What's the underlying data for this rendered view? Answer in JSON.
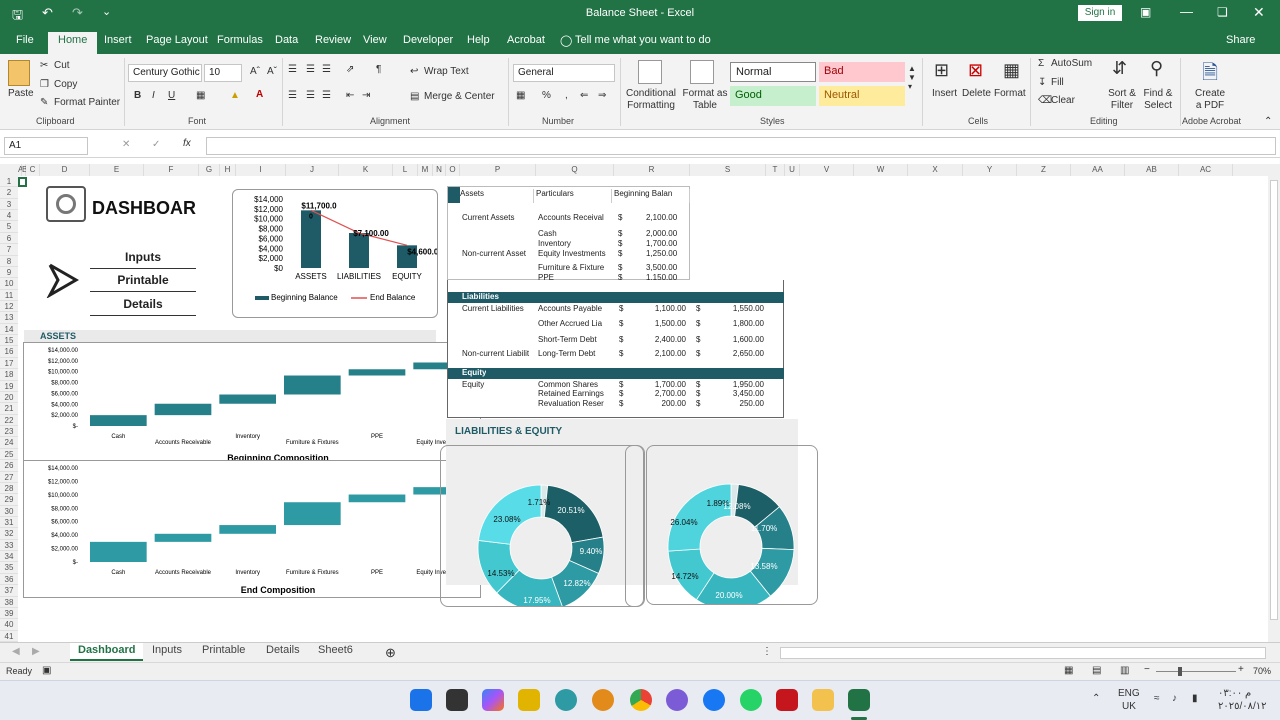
{
  "window": {
    "title": "Balance Sheet  -  Excel",
    "signin": "Sign in"
  },
  "menu": {
    "tabs": [
      "File",
      "Home",
      "Insert",
      "Page Layout",
      "Formulas",
      "Data",
      "Review",
      "View",
      "Developer",
      "Help",
      "Acrobat"
    ],
    "tell": "Tell me what you want to do",
    "share": "Share"
  },
  "ribbon": {
    "clipboard": {
      "paste": "Paste",
      "cut": "Cut",
      "copy": "Copy",
      "format_painter": "Format Painter",
      "label": "Clipboard"
    },
    "font": {
      "name": "Century Gothic",
      "size": "10",
      "bold": "B",
      "italic": "I",
      "underline": "U",
      "label": "Font"
    },
    "alignment": {
      "wrap": "Wrap Text",
      "merge": "Merge & Center",
      "label": "Alignment"
    },
    "number": {
      "format": "General",
      "percent": "%",
      "comma": ",",
      "label": "Number"
    },
    "styles": {
      "cond": "Conditional Formatting",
      "table": "Format as Table",
      "normal": "Normal",
      "bad": "Bad",
      "good": "Good",
      "neutral": "Neutral",
      "label": "Styles"
    },
    "cells": {
      "insert": "Insert",
      "delete": "Delete",
      "format": "Format",
      "label": "Cells"
    },
    "editing": {
      "autosum": "AutoSum",
      "fill": "Fill",
      "clear": "Clear",
      "sort": "Sort & Filter",
      "find": "Find & Select",
      "label": "Editing"
    },
    "acrobat": {
      "create": "Create a PDF",
      "label": "Adobe Acrobat"
    }
  },
  "formula_bar": {
    "namebox": "A1",
    "fx": "fx",
    "content": ""
  },
  "columns": [
    "A",
    "B",
    "C",
    "D",
    "E",
    "F",
    "G",
    "H",
    "I",
    "J",
    "K",
    "L",
    "M",
    "N",
    "O",
    "P",
    "Q",
    "R",
    "S",
    "T",
    "U",
    "V",
    "W",
    "X",
    "Y",
    "Z",
    "AA",
    "AB",
    "AC"
  ],
  "rows": [
    "1",
    "2",
    "3",
    "4",
    "5",
    "6",
    "7",
    "8",
    "9",
    "10",
    "11",
    "12",
    "13",
    "14",
    "15",
    "16",
    "17",
    "18",
    "19",
    "20",
    "21",
    "22",
    "23",
    "24",
    "25",
    "26",
    "27",
    "28",
    "29",
    "30",
    "31",
    "32",
    "33",
    "34",
    "35",
    "36",
    "37",
    "38",
    "39",
    "40",
    "41"
  ],
  "dashboard": {
    "title": "DASHBOAR",
    "inputs": "Inputs",
    "printable": "Printable",
    "details": "Details",
    "assets_label": "ASSETS",
    "liab_equity_label": "LIABILITIES & EQUITY"
  },
  "assets_table": {
    "headers": [
      "Assets",
      "Particulars",
      "Beginning Balan"
    ],
    "rows": [
      {
        "group": "Current Assets",
        "item": "Accounts Receival",
        "cur": "$",
        "val": "2,100.00"
      },
      {
        "group": "",
        "item": "Cash",
        "cur": "$",
        "val": "2,000.00"
      },
      {
        "group": "",
        "item": "Inventory",
        "cur": "$",
        "val": "1,700.00"
      },
      {
        "group": "Non-current Asset",
        "item": "Equity Investments",
        "cur": "$",
        "val": "1,250.00"
      },
      {
        "group": "",
        "item": "Furniture & Fixture",
        "cur": "$",
        "val": "3,500.00"
      },
      {
        "group": "",
        "item": "PPE",
        "cur": "$",
        "val": "1,150.00"
      }
    ]
  },
  "liab_table": {
    "liab_title": "Liabilities",
    "equity_title": "Equity",
    "liab_rows": [
      {
        "group": "Current Liabilities",
        "item": "Accounts Payable",
        "c1": "$",
        "v1": "1,100.00",
        "c2": "$",
        "v2": "1,550.00"
      },
      {
        "group": "",
        "item": "Other Accrued Lia",
        "c1": "$",
        "v1": "1,500.00",
        "c2": "$",
        "v2": "1,800.00"
      },
      {
        "group": "",
        "item": "Short-Term Debt",
        "c1": "$",
        "v1": "2,400.00",
        "c2": "$",
        "v2": "1,600.00"
      },
      {
        "group": "Non-current Liabilit",
        "item": "Long-Term Debt",
        "c1": "$",
        "v1": "2,100.00",
        "c2": "$",
        "v2": "2,650.00"
      }
    ],
    "equity_rows": [
      {
        "group": "Equity",
        "item": "Common Shares",
        "c1": "$",
        "v1": "1,700.00",
        "c2": "$",
        "v2": "1,950.00"
      },
      {
        "group": "",
        "item": "Retained Earnings",
        "c1": "$",
        "v1": "2,700.00",
        "c2": "$",
        "v2": "3,450.00"
      },
      {
        "group": "",
        "item": "Revaluation Reser",
        "c1": "$",
        "v1": "200.00",
        "c2": "$",
        "v2": "250.00"
      }
    ]
  },
  "sheets": {
    "tabs": [
      "Dashboard",
      "Inputs",
      "Printable",
      "Details",
      "Sheet6"
    ]
  },
  "status": {
    "ready": "Ready",
    "zoom": "70%"
  },
  "taskbar": {
    "lang1": "ENG",
    "lang2": "UK",
    "time": "م ٠٣:٠٠",
    "date": "٢٠٢٥/٠٨/١٢"
  },
  "chart_data": [
    {
      "type": "bar",
      "categories": [
        "ASSETS",
        "LIABILITIES",
        "EQUITY"
      ],
      "series": [
        {
          "name": "Beginning Balance",
          "values": [
            11700,
            7100,
            4600
          ]
        },
        {
          "name": "End Balance",
          "values": [
            11700,
            7100,
            4600
          ]
        }
      ],
      "data_labels": [
        "$11,700.0",
        "$7,100.00",
        "$4,600.00"
      ],
      "extra_label": "0",
      "ylim": [
        0,
        14000
      ],
      "yticks": [
        "$14,000",
        "$12,000",
        "$10,000",
        "$8,000",
        "$6,000",
        "$4,000",
        "$2,000",
        "$0"
      ],
      "legend": "bottom"
    },
    {
      "type": "bar",
      "title": "Beginning Composition",
      "categories": [
        "Cash",
        "Accounts Receivable",
        "Inventory",
        "Furniture & Fixtures",
        "PPE",
        "Equity Investments"
      ],
      "values": [
        2000,
        2100,
        1700,
        3500,
        1150,
        1250
      ],
      "ylim": [
        0,
        14000
      ],
      "yticks": [
        "$14,000.00",
        "$12,000.00",
        "$10,000.00",
        "$8,000.00",
        "$6,000.00",
        "$4,000.00",
        "$2,000.00",
        "$-"
      ]
    },
    {
      "type": "bar",
      "title": "End Composition",
      "categories": [
        "Cash",
        "Accounts Receivable",
        "Inventory",
        "Furniture & Fixtures",
        "PPE",
        "Equity Investments"
      ],
      "values": [
        3000,
        1200,
        1300,
        3400,
        1150,
        1100
      ],
      "ylim": [
        0,
        14000
      ],
      "yticks": [
        "$14,000.00",
        "$12,000.00",
        "$10,000.00",
        "$8,000.00",
        "$6,000.00",
        "$4,000.00",
        "$2,000.00",
        "$-"
      ]
    },
    {
      "type": "pie",
      "values": [
        1.71,
        20.51,
        9.4,
        12.82,
        17.95,
        14.53,
        23.08
      ],
      "labels": [
        "1.71%",
        "20.51%",
        "9.40%",
        "12.82%",
        "17.95%",
        "14.53%",
        "23.08%"
      ],
      "colors": [
        "#dbe8ea",
        "#1d5f66",
        "#26808a",
        "#2e9aa4",
        "#38b6bf",
        "#43c8d0",
        "#58dde8"
      ]
    },
    {
      "type": "pie",
      "values": [
        1.89,
        12.08,
        11.7,
        13.58,
        20.0,
        14.72,
        26.04
      ],
      "labels": [
        "1.89%",
        "12.08%",
        "11.70%",
        "13.58%",
        "20.00%",
        "14.72%",
        "26.04%"
      ],
      "colors": [
        "#dbe8ea",
        "#1d5f66",
        "#26808a",
        "#2e9aa4",
        "#38b6bf",
        "#43c8d0",
        "#4fd3dc"
      ]
    }
  ]
}
